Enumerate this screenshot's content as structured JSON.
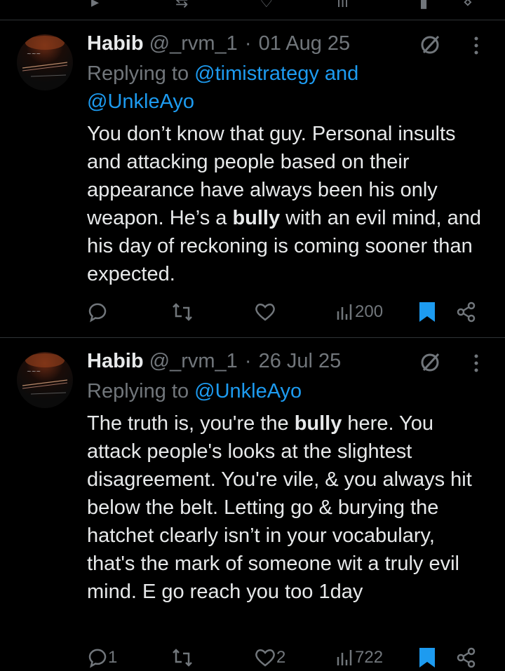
{
  "tweets": [
    {
      "display_name": "Habib",
      "handle": "@_rvm_1",
      "separator": "·",
      "date": "01 Aug 25",
      "replying_prefix": "Replying to ",
      "replying_mention_1": "@timistrategy and",
      "replying_mention_2": "@UnkleAyo",
      "body_before": "You don’t know that guy. Personal insults and attacking people based on their appearance have always been his only weapon. He’s a ",
      "body_bold": "bully",
      "body_after": " with an evil mind, and his day of reckoning is coming sooner than expected.",
      "reply_count": "",
      "retweet_count": "",
      "like_count": "",
      "view_count": "200"
    },
    {
      "display_name": "Habib",
      "handle": "@_rvm_1",
      "separator": "·",
      "date": "26 Jul 25",
      "replying_prefix": "Replying to ",
      "replying_mention_1": "@UnkleAyo",
      "body_before": "The truth is, you're the ",
      "body_bold": "bully",
      "body_after": " here. You attack people's looks at the slightest disagreement. You're vile, & you always hit below the belt. Letting go & burying the hatchet clearly isn’t in your vocabulary, that's the mark of someone wit a truly evil mind. E go reach you too 1day",
      "reply_count": "1",
      "retweet_count": "",
      "like_count": "2",
      "view_count": "722"
    }
  ],
  "colors": {
    "background": "#000000",
    "text": "#e7e9ea",
    "muted": "#71767b",
    "accent": "#1d9bf0",
    "divider": "#2f3336"
  },
  "icons": [
    "reply-icon",
    "retweet-icon",
    "like-icon",
    "views-icon",
    "bookmark-icon",
    "share-icon",
    "grok-icon",
    "more-icon"
  ]
}
